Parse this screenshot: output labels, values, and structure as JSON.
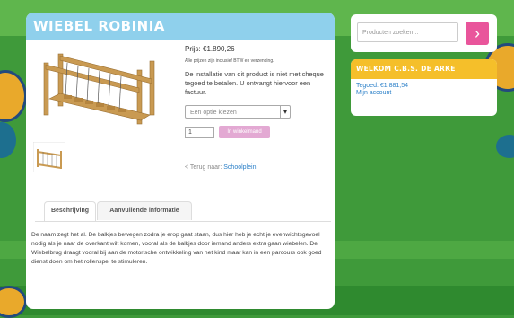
{
  "product": {
    "title": "WIEBEL ROBINIA",
    "price": "Prijs: €1.890,26",
    "vat_note": "Alle prijzen zijn inclusief BTW en verzending.",
    "installation_notice": "De installatie van dit product is niet met cheque tegoed te betalen. U ontvangt hiervoor een factuur.",
    "option_placeholder": "Een optie kiezen",
    "quantity": "1",
    "add_to_cart_label": "In winkelmand",
    "back_prefix": "< Terug naar: ",
    "back_link": "Schoolplein"
  },
  "tabs": [
    {
      "label": "Beschrijving",
      "active": true
    },
    {
      "label": "Aanvullende informatie",
      "active": false
    }
  ],
  "description": "De naam zegt het al. De balkjes bewegen zodra je erop gaat staan, dus hier heb je echt je evenwichtsgevoel nodig als je naar de overkant wilt komen, vooral als de balkjes door iemand anders extra gaan wiebelen. De Wiebelbrug draagt vooral bij aan de motorische ontwikkeling van het kind maar kan in een parcours ook goed dienst doen om het rollenspel te stimuleren.",
  "sidebar": {
    "search_placeholder": "Producten zoeken...",
    "search_button_icon": "chevron-right-icon",
    "account_title": "WELKOM C.B.S. DE ARKE",
    "credit": "Tegoed: €1.881,54",
    "my_account": "Mijn account"
  },
  "colors": {
    "header_blue": "#8fd0ec",
    "search_pink": "#e9559b",
    "account_yellow": "#f5bf2a",
    "link_blue": "#2a7fc8",
    "background_green": "#3f9a3a"
  }
}
